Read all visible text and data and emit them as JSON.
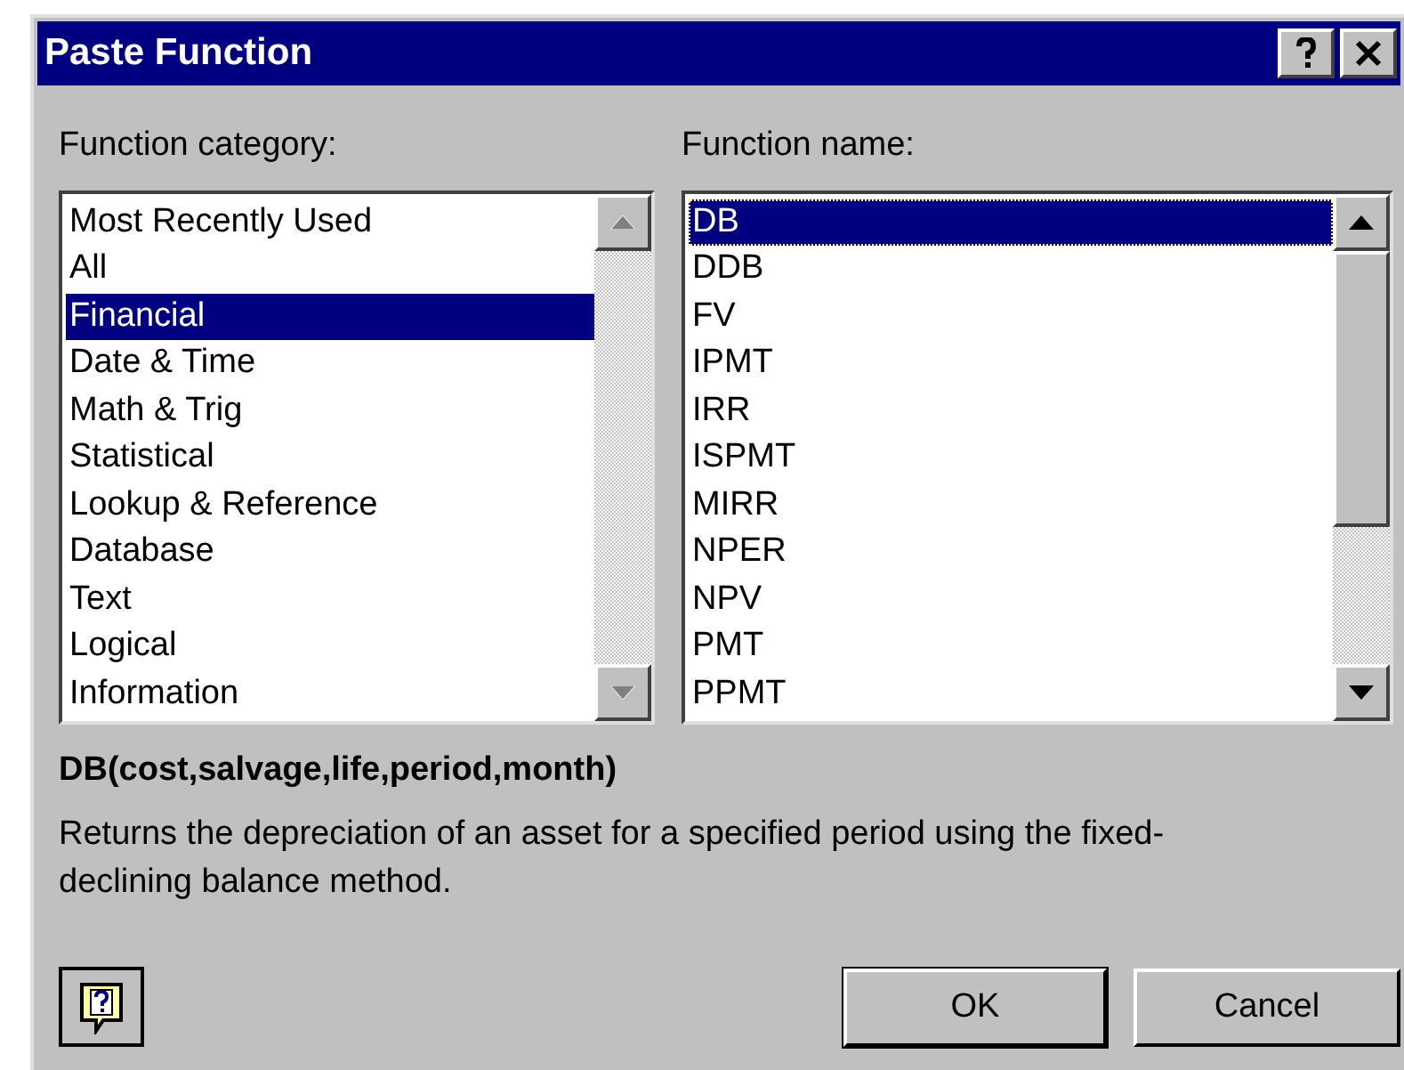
{
  "window": {
    "title": "Paste Function"
  },
  "category_list": {
    "label": "Function category:",
    "scrollbar_disabled": true,
    "items": [
      {
        "label": "Most Recently Used",
        "selected": false
      },
      {
        "label": "All",
        "selected": false
      },
      {
        "label": "Financial",
        "selected": true
      },
      {
        "label": "Date & Time",
        "selected": false
      },
      {
        "label": "Math & Trig",
        "selected": false
      },
      {
        "label": "Statistical",
        "selected": false
      },
      {
        "label": "Lookup & Reference",
        "selected": false
      },
      {
        "label": "Database",
        "selected": false
      },
      {
        "label": "Text",
        "selected": false
      },
      {
        "label": "Logical",
        "selected": false
      },
      {
        "label": "Information",
        "selected": false
      }
    ]
  },
  "function_list": {
    "label": "Function name:",
    "scrollbar_disabled": false,
    "items": [
      {
        "label": "DB",
        "selected": true
      },
      {
        "label": "DDB",
        "selected": false
      },
      {
        "label": "FV",
        "selected": false
      },
      {
        "label": "IPMT",
        "selected": false
      },
      {
        "label": "IRR",
        "selected": false
      },
      {
        "label": "ISPMT",
        "selected": false
      },
      {
        "label": "MIRR",
        "selected": false
      },
      {
        "label": "NPER",
        "selected": false
      },
      {
        "label": "NPV",
        "selected": false
      },
      {
        "label": "PMT",
        "selected": false
      },
      {
        "label": "PPMT",
        "selected": false
      }
    ]
  },
  "signature": "DB(cost,salvage,life,period,month)",
  "description": "Returns the depreciation of an asset for a specified period using the fixed-declining balance method.",
  "buttons": [
    {
      "label": "OK"
    },
    {
      "label": "Cancel"
    }
  ]
}
